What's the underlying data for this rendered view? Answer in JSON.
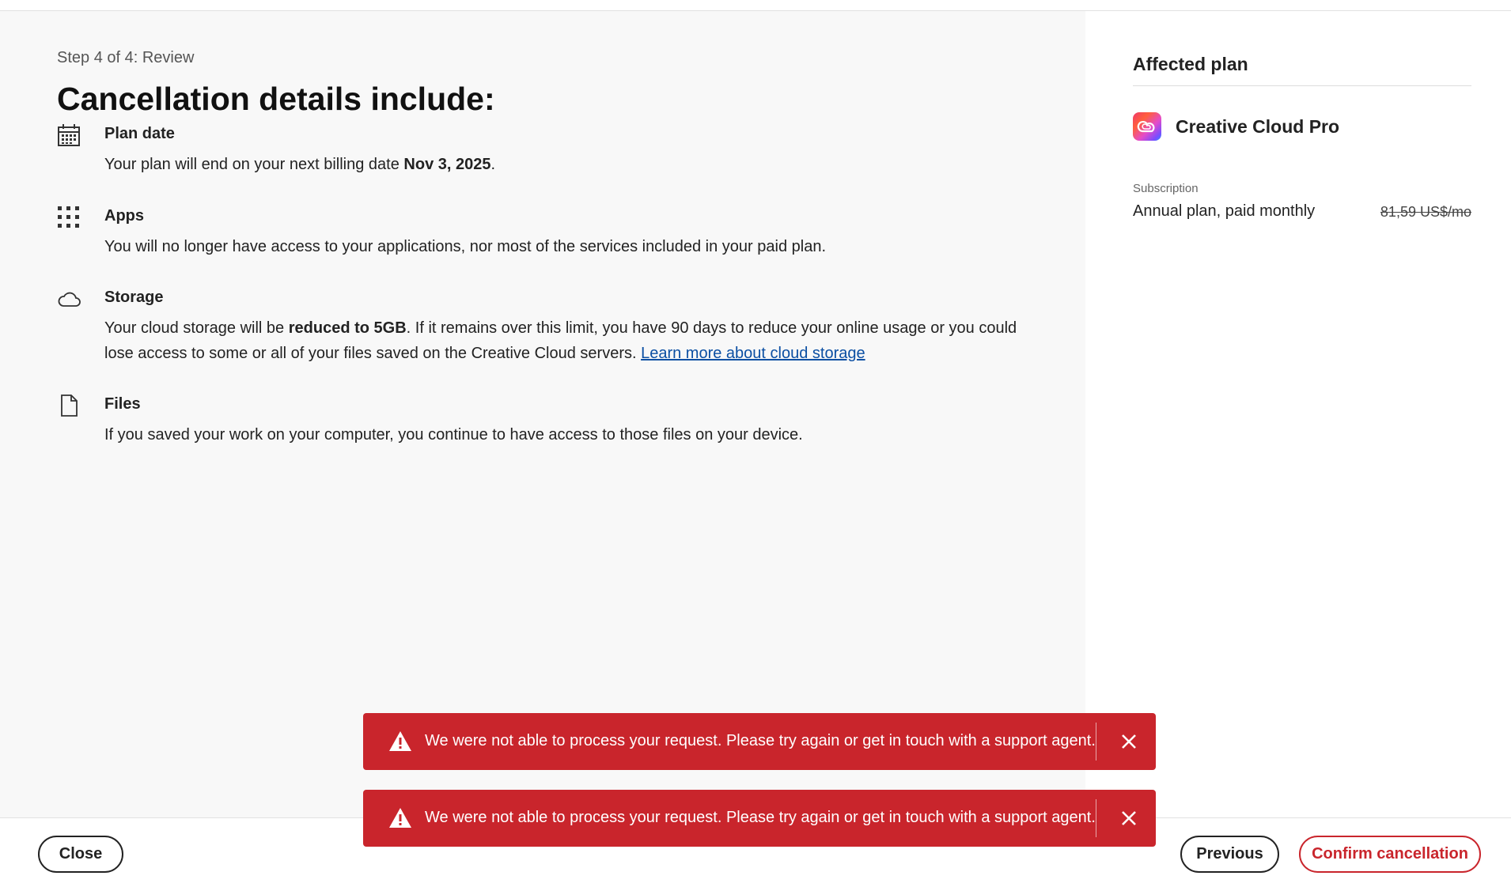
{
  "main": {
    "step": "Step 4 of 4: Review",
    "title": "Cancellation details include:",
    "items": [
      {
        "icon": "calendar-icon",
        "heading": "Plan date",
        "text_before": "Your plan will end on your next billing date ",
        "bold": "Nov 3, 2025",
        "text_after": "."
      },
      {
        "icon": "apps-grid-icon",
        "heading": "Apps",
        "text": "You will no longer have access to your applications, nor most of the services included in your paid plan."
      },
      {
        "icon": "cloud-icon",
        "heading": "Storage",
        "text_before": "Your cloud storage will be ",
        "bold": "reduced to 5GB",
        "text_after": ". If it remains over this limit, you have 90 days to reduce your online usage or you could lose access to some or all of your files saved on the Creative Cloud servers. ",
        "link": "Learn more about cloud storage"
      },
      {
        "icon": "file-icon",
        "heading": "Files",
        "text": "If you saved your work on your computer, you continue to have access to those files on your device."
      }
    ]
  },
  "aside": {
    "heading": "Affected plan",
    "product_name": "Creative Cloud Pro",
    "subscription_label": "Subscription",
    "plan": "Annual plan, paid monthly",
    "price": "81,59 US$/mo"
  },
  "toasts": [
    {
      "message": "We were not able to process your request. Please try again or get in touch with a support agent."
    },
    {
      "message": "We were not able to process your request. Please try again or get in touch with a support agent."
    }
  ],
  "footer": {
    "close_label": "Close",
    "previous_label": "Previous",
    "confirm_label": "Confirm cancellation"
  },
  "colors": {
    "error": "#c9252c",
    "link": "#0b4fa3",
    "main_bg": "#f8f8f8"
  }
}
